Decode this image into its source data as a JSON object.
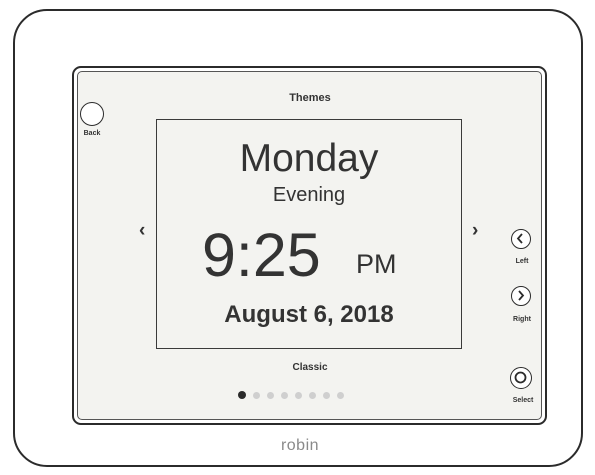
{
  "device": {
    "brand": "robin"
  },
  "screen": {
    "title": "Themes",
    "clock": {
      "day": "Monday",
      "period": "Evening",
      "time": "9:25",
      "ampm": "PM",
      "date": "August 6, 2018"
    },
    "theme_name": "Classic",
    "pagination": {
      "current": 1,
      "total": 8
    },
    "nav": {
      "prev_glyph": "‹",
      "next_glyph": "›"
    }
  },
  "buttons": {
    "back_label": "Back",
    "left_label": "Left",
    "right_label": "Right",
    "select_label": "Select"
  },
  "icons": {
    "left": "chevron-left-icon",
    "right": "chevron-right-icon",
    "select": "target-circle-icon"
  },
  "colors": {
    "screen_bg": "#f3f3f0",
    "outline": "#2b2b2b",
    "active_dot": "#2a2a2a",
    "inactive_dot": "#cfcfcf",
    "brand_text": "#8a8a8a"
  }
}
